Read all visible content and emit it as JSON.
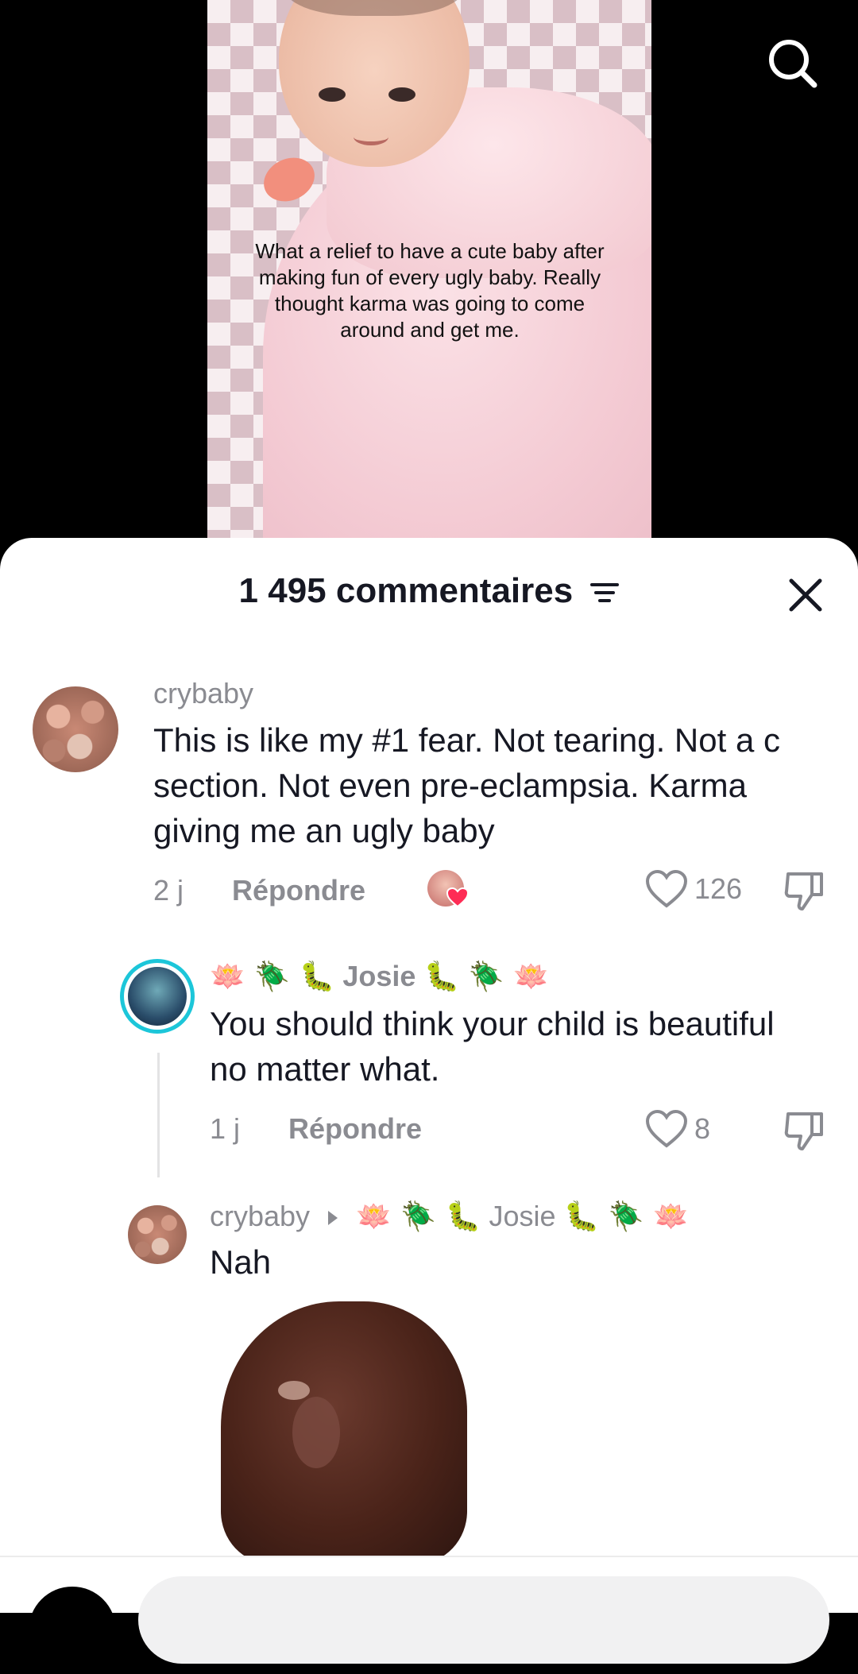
{
  "video": {
    "caption": "What a relief to have a cute baby after making fun of every ugly baby. Really thought karma was going to come around and get me.",
    "search_icon": "search-icon"
  },
  "comments_panel": {
    "title": "1 495 commentaires",
    "filter_icon": "filter-icon",
    "close_icon": "close-icon"
  },
  "comments": [
    {
      "username": "crybaby",
      "text": "This is like my #1 fear. Not tearing. Not a c section. Not even pre-eclampsia. Karma giving me an ugly baby",
      "time": "2 j",
      "reply_label": "Répondre",
      "likes": "126"
    },
    {
      "username_prefix": "🪷 🪲 🐛",
      "username": "Josie",
      "username_suffix": "🐛 🪲 🪷",
      "text": "You should think your child is beautiful no matter what.",
      "time": "1 j",
      "reply_label": "Répondre",
      "likes": "8"
    },
    {
      "username": "crybaby",
      "reply_to_prefix": "🪷 🪲 🐛",
      "reply_to": "Josie",
      "reply_to_suffix": "🐛 🪲 🪷",
      "text": "Nah"
    }
  ],
  "colors": {
    "accent_ring": "#1cc6d9",
    "muted_text": "#8a8b91",
    "primary_text": "#161823",
    "heart_red": "#fe2c55"
  }
}
